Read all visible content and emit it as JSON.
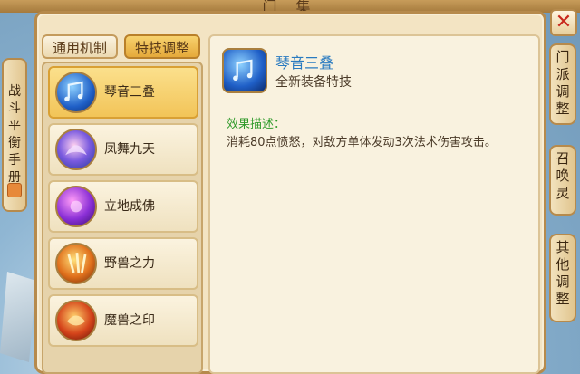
{
  "window": {
    "title": "门 集"
  },
  "tabs": [
    {
      "label": "通用机制",
      "active": false
    },
    {
      "label": "特技调整",
      "active": true
    }
  ],
  "skills": [
    {
      "name": "琴音三叠",
      "icon": "blue-lyre-icon",
      "selected": true
    },
    {
      "name": "凤舞九天",
      "icon": "blue-phoenix-icon",
      "selected": false
    },
    {
      "name": "立地成佛",
      "icon": "purple-orb-icon",
      "selected": false
    },
    {
      "name": "野兽之力",
      "icon": "orange-beast-icon",
      "selected": false
    },
    {
      "name": "魔兽之印",
      "icon": "red-seal-icon",
      "selected": false
    }
  ],
  "detail": {
    "name": "琴音三叠",
    "subtitle": "全新装备特技",
    "effect_title": "效果描述：",
    "effect_desc": "消耗80点愤怒，对敌方单体发动3次法术伤害攻击。"
  },
  "left_side_tab": {
    "label": "战斗平衡手册"
  },
  "right_side_tabs": [
    {
      "label": "门派调整"
    },
    {
      "label": "召唤灵"
    },
    {
      "label": "其他调整"
    }
  ],
  "close_icon": "close-x-icon",
  "colors": {
    "accent_gold": "#e5a93a",
    "name_blue": "#2a7bc0",
    "effect_green": "#2f9a2a",
    "close_red": "#c8281d"
  }
}
